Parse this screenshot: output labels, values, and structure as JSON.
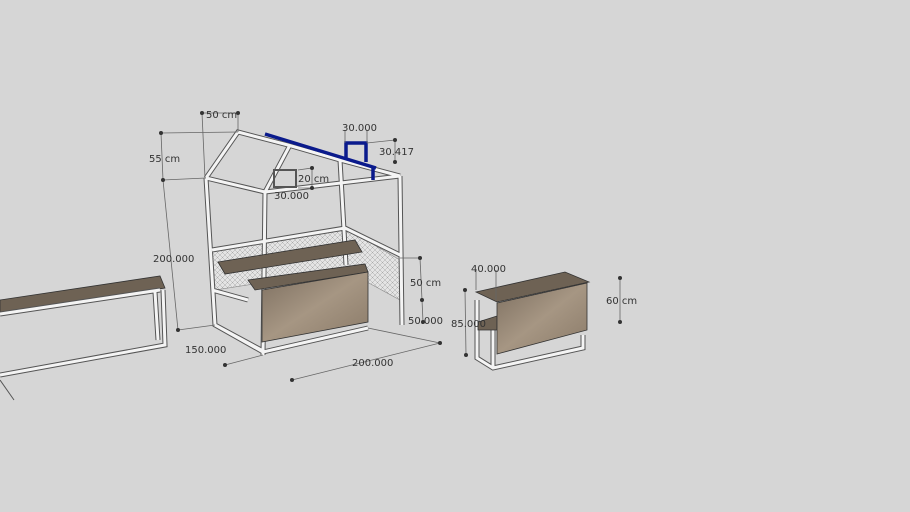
{
  "dimensions": {
    "roof_width": "50 cm",
    "roof_height": "55 cm",
    "chimney_width": "30.000",
    "chimney_height": "30.417",
    "window_height": "20 cm",
    "window_width": "30.000",
    "total_height": "200.000",
    "bench_gap": "50 cm",
    "bench_height": "50.000",
    "depth": "150.000",
    "length": "200.000",
    "table_depth": "40.000",
    "table_height": "85.000",
    "table_leaf": "60 cm"
  },
  "colors": {
    "background": "#d6d6d6",
    "roof_accent": "#0a1a8c",
    "wood": "#8a7a66"
  }
}
